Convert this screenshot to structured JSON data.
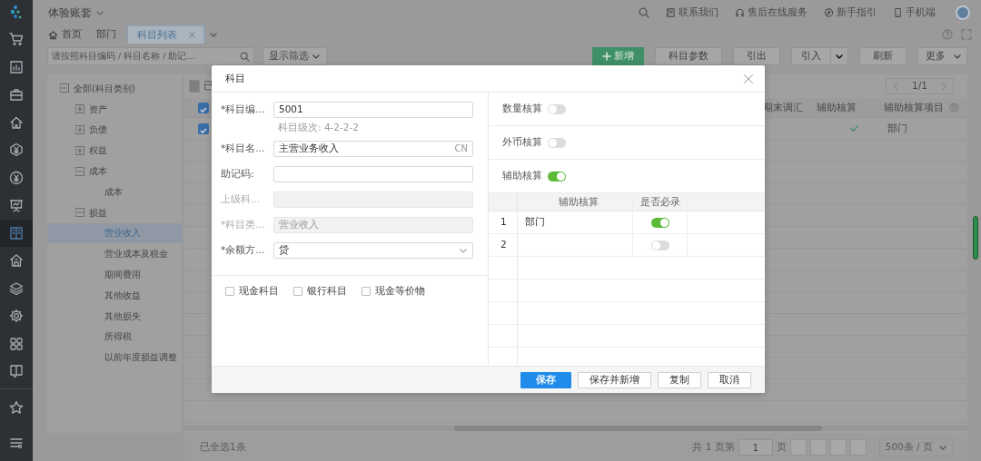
{
  "account_set": {
    "name": "体验账套"
  },
  "header_links": [
    {
      "label": "联系我们"
    },
    {
      "label": "售后在线服务"
    },
    {
      "label": "新手指引"
    },
    {
      "label": "手机端"
    }
  ],
  "sidebar": {
    "items": [
      {
        "selected": false
      },
      {
        "selected": false
      },
      {
        "selected": false
      },
      {
        "selected": false
      },
      {
        "selected": false
      },
      {
        "selected": false
      },
      {
        "selected": false
      },
      {
        "selected": true
      },
      {
        "selected": false
      },
      {
        "selected": false
      },
      {
        "selected": false
      },
      {
        "selected": false
      },
      {
        "selected": false
      },
      {
        "selected": false
      },
      {
        "selected": false
      }
    ]
  },
  "tabs": [
    {
      "label": "首页",
      "selected": false,
      "closable": false
    },
    {
      "label": "部门",
      "selected": false,
      "closable": false
    },
    {
      "label": "科目列表",
      "selected": true,
      "closable": true
    }
  ],
  "toolbar": {
    "search": {
      "placeholder": "请按照科目编码 / 科目名称 / 助记..."
    },
    "filter": "显示筛选",
    "buttons": [
      {
        "label": "新增",
        "kind": "primary"
      },
      {
        "label": "科目参数",
        "kind": "default"
      },
      {
        "label": "引出",
        "kind": "default"
      },
      {
        "label": "引入",
        "kind": "split"
      },
      {
        "label": "刷新",
        "kind": "default"
      },
      {
        "label": "更多",
        "kind": "dropdown"
      }
    ]
  },
  "tree": [
    {
      "label": "全部(科目类别)",
      "expanded": true,
      "selected": false,
      "children": [
        {
          "label": "资产",
          "expanded": false,
          "selected": false
        },
        {
          "label": "负债",
          "expanded": false,
          "selected": false
        },
        {
          "label": "权益",
          "expanded": false,
          "selected": false
        },
        {
          "label": "成本",
          "expanded": true,
          "selected": false,
          "children": [
            {
              "label": "成本",
              "selected": false
            }
          ]
        },
        {
          "label": "损益",
          "expanded": true,
          "selected": false,
          "children": [
            {
              "label": "营业收入",
              "selected": true
            },
            {
              "label": "营业成本及税金",
              "selected": false
            },
            {
              "label": "期间费用",
              "selected": false
            },
            {
              "label": "其他收益",
              "selected": false
            },
            {
              "label": "其他损失",
              "selected": false
            },
            {
              "label": "所得税",
              "selected": false
            },
            {
              "label": "以前年度损益调整",
              "selected": false
            }
          ]
        }
      ]
    }
  ],
  "table": {
    "title": "已",
    "pager": "1/1",
    "all_checked": true,
    "columns": [
      "期末调汇",
      "辅助核算",
      "辅助核算项目"
    ],
    "rows": [
      {
        "checked": true,
        "aux": true,
        "aux_items": "部门"
      }
    ]
  },
  "footer": {
    "summary": "已全选1条",
    "total": "共 1 页第",
    "page": "1",
    "page_unit": "页",
    "page_size": "500条 / 页"
  },
  "dialog": {
    "title": "科目",
    "fields": [
      {
        "kind": "text",
        "label": "*科目编...",
        "value": "5001",
        "disabled": false
      },
      {
        "kind": "hint",
        "text": "科目级次: 4-2-2-2"
      },
      {
        "kind": "text",
        "label": "*科目名...",
        "value": "主营业务收入",
        "suffix": "CN",
        "disabled": false
      },
      {
        "kind": "text",
        "label": "助记码:",
        "disabled": false
      },
      {
        "kind": "text",
        "label": "上级科...",
        "disabled": true
      },
      {
        "kind": "text",
        "label": "*科目类...",
        "value": "营业收入",
        "disabled": true
      },
      {
        "kind": "select",
        "label": "*余额方...",
        "value": "贷",
        "disabled": false
      }
    ],
    "options": [
      {
        "label": "现金科目",
        "checked": false
      },
      {
        "label": "银行科目",
        "checked": false
      },
      {
        "label": "现金等价物",
        "checked": false
      }
    ],
    "switches": [
      {
        "label": "数量核算",
        "on": false
      },
      {
        "label": "外币核算",
        "on": false
      },
      {
        "label": "辅助核算",
        "on": true
      }
    ],
    "aux_table": {
      "columns": [
        "辅助核算",
        "是否必录"
      ],
      "rows": [
        {
          "index": "1",
          "item": "部门",
          "required": true
        },
        {
          "index": "2",
          "required": false
        }
      ]
    },
    "buttons": [
      {
        "label": "保存",
        "kind": "primary"
      },
      {
        "label": "保存并新增",
        "kind": "default"
      },
      {
        "label": "复制",
        "kind": "default"
      },
      {
        "label": "取消",
        "kind": "default"
      }
    ]
  }
}
